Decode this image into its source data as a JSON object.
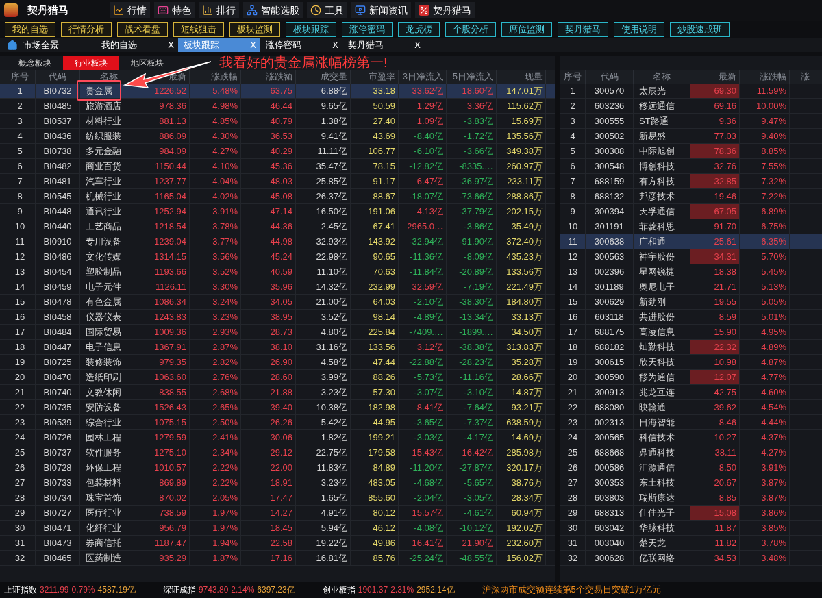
{
  "app": {
    "title": "契丹猎马"
  },
  "menu": [
    {
      "label": "行情"
    },
    {
      "label": "特色"
    },
    {
      "label": "排行"
    },
    {
      "label": "智能选股"
    },
    {
      "label": "工具"
    },
    {
      "label": "新闻资讯"
    },
    {
      "label": "契丹猎马"
    }
  ],
  "quick_buttons": [
    {
      "label": "我的自选",
      "kind": "gold"
    },
    {
      "label": "行情分析",
      "kind": "gold"
    },
    {
      "label": "战术看盘",
      "kind": "gold"
    },
    {
      "label": "短线狙击",
      "kind": "gold"
    },
    {
      "label": "板块监测",
      "kind": "gold"
    },
    {
      "label": "板块跟踪",
      "kind": "cyan"
    },
    {
      "label": "涨停密码",
      "kind": "cyan"
    },
    {
      "label": "龙虎榜",
      "kind": "cyan"
    },
    {
      "label": "个股分析",
      "kind": "cyan"
    },
    {
      "label": "席位监测",
      "kind": "cyan"
    },
    {
      "label": "契丹猎马",
      "kind": "cyan"
    },
    {
      "label": "使用说明",
      "kind": "cyan"
    },
    {
      "label": "炒股速成班",
      "kind": "cyan"
    }
  ],
  "home_tab": {
    "label": "市场全景"
  },
  "tabs": [
    {
      "label": "我的自选",
      "close": "X",
      "selected": false
    },
    {
      "label": "板块跟踪",
      "close": "X",
      "selected": true
    },
    {
      "label": "涨停密码",
      "close": "X",
      "selected": false
    },
    {
      "label": "契丹猎马",
      "close": "X",
      "selected": false
    }
  ],
  "sector_tabs": [
    {
      "label": "概念板块",
      "selected": false
    },
    {
      "label": "行业板块",
      "selected": true
    },
    {
      "label": "地区板块",
      "selected": false
    }
  ],
  "annotation": {
    "text": "我看好的贵金属涨幅榜第一!"
  },
  "sector_table": {
    "columns": [
      "序号",
      "代码",
      "名称",
      "最新",
      "涨跌幅",
      "涨跌额",
      "成交量",
      "市盈率",
      "3日净流入",
      "5日净流入",
      "现量"
    ],
    "rows": [
      {
        "selected": true,
        "inflow": [
          true,
          true
        ],
        "cells": [
          "1",
          "BI0732",
          "贵金属",
          "1226.52",
          "5.48%",
          "63.75",
          "6.88亿",
          "33.18",
          "33.62亿",
          "18.60亿",
          "147.01万"
        ]
      },
      {
        "selected": false,
        "inflow": [
          true,
          true
        ],
        "cells": [
          "2",
          "BI0485",
          "旅游酒店",
          "978.36",
          "4.98%",
          "46.44",
          "9.65亿",
          "50.59",
          "1.29亿",
          "3.36亿",
          "115.62万"
        ]
      },
      {
        "selected": false,
        "inflow": [
          true,
          false
        ],
        "cells": [
          "3",
          "BI0537",
          "材料行业",
          "881.13",
          "4.85%",
          "40.79",
          "1.38亿",
          "27.40",
          "1.09亿",
          "-3.83亿",
          "15.69万"
        ]
      },
      {
        "selected": false,
        "inflow": [
          false,
          false
        ],
        "cells": [
          "4",
          "BI0436",
          "纺织服装",
          "886.09",
          "4.30%",
          "36.53",
          "9.41亿",
          "43.69",
          "-8.40亿",
          "-1.72亿",
          "135.56万"
        ]
      },
      {
        "selected": false,
        "inflow": [
          false,
          false
        ],
        "cells": [
          "5",
          "BI0738",
          "多元金融",
          "984.09",
          "4.27%",
          "40.29",
          "11.11亿",
          "106.77",
          "-6.10亿",
          "-3.66亿",
          "349.38万"
        ]
      },
      {
        "selected": false,
        "inflow": [
          false,
          false
        ],
        "cells": [
          "6",
          "BI0482",
          "商业百货",
          "1150.44",
          "4.10%",
          "45.36",
          "35.47亿",
          "78.15",
          "-12.82亿",
          "-8335.…",
          "260.97万"
        ]
      },
      {
        "selected": false,
        "inflow": [
          true,
          false
        ],
        "cells": [
          "7",
          "BI0481",
          "汽车行业",
          "1237.77",
          "4.04%",
          "48.03",
          "25.85亿",
          "91.17",
          "6.47亿",
          "-36.97亿",
          "233.11万"
        ]
      },
      {
        "selected": false,
        "inflow": [
          false,
          false
        ],
        "cells": [
          "8",
          "BI0545",
          "机械行业",
          "1165.04",
          "4.02%",
          "45.08",
          "26.37亿",
          "88.67",
          "-18.07亿",
          "-73.66亿",
          "288.86万"
        ]
      },
      {
        "selected": false,
        "inflow": [
          true,
          false
        ],
        "cells": [
          "9",
          "BI0448",
          "通讯行业",
          "1252.94",
          "3.91%",
          "47.14",
          "16.50亿",
          "191.06",
          "4.13亿",
          "-37.79亿",
          "202.15万"
        ]
      },
      {
        "selected": false,
        "inflow": [
          true,
          false
        ],
        "cells": [
          "10",
          "BI0440",
          "工艺商品",
          "1218.54",
          "3.78%",
          "44.36",
          "2.45亿",
          "67.41",
          "2965.0…",
          "-3.86亿",
          "35.49万"
        ]
      },
      {
        "selected": false,
        "inflow": [
          false,
          false
        ],
        "cells": [
          "11",
          "BI0910",
          "专用设备",
          "1239.04",
          "3.77%",
          "44.98",
          "32.93亿",
          "143.92",
          "-32.94亿",
          "-91.90亿",
          "372.40万"
        ]
      },
      {
        "selected": false,
        "inflow": [
          false,
          false
        ],
        "cells": [
          "12",
          "BI0486",
          "文化传媒",
          "1314.15",
          "3.56%",
          "45.24",
          "22.98亿",
          "90.65",
          "-11.36亿",
          "-8.09亿",
          "435.23万"
        ]
      },
      {
        "selected": false,
        "inflow": [
          false,
          false
        ],
        "cells": [
          "13",
          "BI0454",
          "塑胶制品",
          "1193.66",
          "3.52%",
          "40.59",
          "11.10亿",
          "70.63",
          "-11.84亿",
          "-20.89亿",
          "133.56万"
        ]
      },
      {
        "selected": false,
        "inflow": [
          true,
          false
        ],
        "cells": [
          "14",
          "BI0459",
          "电子元件",
          "1126.11",
          "3.30%",
          "35.96",
          "14.32亿",
          "232.99",
          "32.59亿",
          "-7.19亿",
          "221.49万"
        ]
      },
      {
        "selected": false,
        "inflow": [
          false,
          false
        ],
        "cells": [
          "15",
          "BI0478",
          "有色金属",
          "1086.34",
          "3.24%",
          "34.05",
          "21.00亿",
          "64.03",
          "-2.10亿",
          "-38.30亿",
          "184.80万"
        ]
      },
      {
        "selected": false,
        "inflow": [
          false,
          false
        ],
        "cells": [
          "16",
          "BI0458",
          "仪器仪表",
          "1243.83",
          "3.23%",
          "38.95",
          "3.52亿",
          "98.14",
          "-4.89亿",
          "-13.34亿",
          "33.13万"
        ]
      },
      {
        "selected": false,
        "inflow": [
          false,
          false
        ],
        "cells": [
          "17",
          "BI0484",
          "国际贸易",
          "1009.36",
          "2.93%",
          "28.73",
          "4.80亿",
          "225.84",
          "-7409.…",
          "-1899.…",
          "34.50万"
        ]
      },
      {
        "selected": false,
        "inflow": [
          true,
          false
        ],
        "cells": [
          "18",
          "BI0447",
          "电子信息",
          "1367.91",
          "2.87%",
          "38.10",
          "31.16亿",
          "133.56",
          "3.12亿",
          "-38.38亿",
          "313.83万"
        ]
      },
      {
        "selected": false,
        "inflow": [
          false,
          false
        ],
        "cells": [
          "19",
          "BI0725",
          "装修装饰",
          "979.35",
          "2.82%",
          "26.90",
          "4.58亿",
          "47.44",
          "-22.88亿",
          "-28.23亿",
          "35.28万"
        ]
      },
      {
        "selected": false,
        "inflow": [
          false,
          false
        ],
        "cells": [
          "20",
          "BI0470",
          "造纸印刷",
          "1063.60",
          "2.76%",
          "28.60",
          "3.99亿",
          "88.26",
          "-5.73亿",
          "-11.16亿",
          "28.66万"
        ]
      },
      {
        "selected": false,
        "inflow": [
          false,
          false
        ],
        "cells": [
          "21",
          "BI0740",
          "文教休闲",
          "838.55",
          "2.68%",
          "21.88",
          "3.23亿",
          "57.30",
          "-3.07亿",
          "-3.10亿",
          "14.87万"
        ]
      },
      {
        "selected": false,
        "inflow": [
          true,
          false
        ],
        "cells": [
          "22",
          "BI0735",
          "安防设备",
          "1526.43",
          "2.65%",
          "39.40",
          "10.38亿",
          "182.98",
          "8.41亿",
          "-7.64亿",
          "93.21万"
        ]
      },
      {
        "selected": false,
        "inflow": [
          false,
          false
        ],
        "cells": [
          "23",
          "BI0539",
          "综合行业",
          "1075.15",
          "2.50%",
          "26.26",
          "5.42亿",
          "44.95",
          "-3.65亿",
          "-7.37亿",
          "638.59万"
        ]
      },
      {
        "selected": false,
        "inflow": [
          false,
          false
        ],
        "cells": [
          "24",
          "BI0726",
          "园林工程",
          "1279.59",
          "2.41%",
          "30.06",
          "1.82亿",
          "199.21",
          "-3.03亿",
          "-4.17亿",
          "14.69万"
        ]
      },
      {
        "selected": false,
        "inflow": [
          true,
          true
        ],
        "cells": [
          "25",
          "BI0737",
          "软件服务",
          "1275.10",
          "2.34%",
          "29.12",
          "22.75亿",
          "179.58",
          "15.43亿",
          "16.42亿",
          "285.98万"
        ]
      },
      {
        "selected": false,
        "inflow": [
          false,
          false
        ],
        "cells": [
          "26",
          "BI0728",
          "环保工程",
          "1010.57",
          "2.22%",
          "22.00",
          "11.83亿",
          "84.89",
          "-11.20亿",
          "-27.87亿",
          "320.17万"
        ]
      },
      {
        "selected": false,
        "inflow": [
          false,
          false
        ],
        "cells": [
          "27",
          "BI0733",
          "包装材料",
          "869.89",
          "2.22%",
          "18.91",
          "3.23亿",
          "483.05",
          "-4.68亿",
          "-5.65亿",
          "38.76万"
        ]
      },
      {
        "selected": false,
        "inflow": [
          false,
          false
        ],
        "cells": [
          "28",
          "BI0734",
          "珠宝首饰",
          "870.02",
          "2.05%",
          "17.47",
          "1.65亿",
          "855.60",
          "-2.04亿",
          "-3.05亿",
          "28.34万"
        ]
      },
      {
        "selected": false,
        "inflow": [
          true,
          false
        ],
        "cells": [
          "29",
          "BI0727",
          "医疗行业",
          "738.59",
          "1.97%",
          "14.27",
          "4.91亿",
          "80.12",
          "15.57亿",
          "-4.61亿",
          "60.94万"
        ]
      },
      {
        "selected": false,
        "inflow": [
          false,
          false
        ],
        "cells": [
          "30",
          "BI0471",
          "化纤行业",
          "956.79",
          "1.97%",
          "18.45",
          "5.94亿",
          "46.12",
          "-4.08亿",
          "-10.12亿",
          "192.02万"
        ]
      },
      {
        "selected": false,
        "inflow": [
          true,
          true
        ],
        "cells": [
          "31",
          "BI0473",
          "券商信托",
          "1187.47",
          "1.94%",
          "22.58",
          "19.22亿",
          "49.86",
          "16.41亿",
          "21.90亿",
          "232.60万"
        ]
      },
      {
        "selected": false,
        "inflow": [
          false,
          false
        ],
        "cells": [
          "32",
          "BI0465",
          "医药制造",
          "935.29",
          "1.87%",
          "17.16",
          "16.81亿",
          "85.76",
          "-25.24亿",
          "-48.55亿",
          "156.02万"
        ]
      }
    ]
  },
  "stock_table": {
    "columns": [
      "序号",
      "代码",
      "名称",
      "最新",
      "涨跌幅",
      "涨"
    ],
    "rows": [
      {
        "selected": false,
        "highlighted": true,
        "cells": [
          "1",
          "300570",
          "太辰光",
          "69.30",
          "11.59%"
        ]
      },
      {
        "selected": false,
        "highlighted": false,
        "cells": [
          "2",
          "603236",
          "移远通信",
          "69.16",
          "10.00%"
        ]
      },
      {
        "selected": false,
        "highlighted": false,
        "cells": [
          "3",
          "300555",
          "ST路通",
          "9.36",
          "9.47%"
        ]
      },
      {
        "selected": false,
        "highlighted": false,
        "cells": [
          "4",
          "300502",
          "新易盛",
          "77.03",
          "9.40%"
        ]
      },
      {
        "selected": false,
        "highlighted": true,
        "cells": [
          "5",
          "300308",
          "中际旭创",
          "78.36",
          "8.85%"
        ]
      },
      {
        "selected": false,
        "highlighted": false,
        "cells": [
          "6",
          "300548",
          "博创科技",
          "32.76",
          "7.55%"
        ]
      },
      {
        "selected": false,
        "highlighted": true,
        "cells": [
          "7",
          "688159",
          "有方科技",
          "32.85",
          "7.32%"
        ]
      },
      {
        "selected": false,
        "highlighted": false,
        "cells": [
          "8",
          "688132",
          "邦彦技术",
          "19.46",
          "7.22%"
        ]
      },
      {
        "selected": false,
        "highlighted": true,
        "cells": [
          "9",
          "300394",
          "天孚通信",
          "67.05",
          "6.89%"
        ]
      },
      {
        "selected": false,
        "highlighted": false,
        "cells": [
          "10",
          "301191",
          "菲菱科思",
          "91.70",
          "6.75%"
        ]
      },
      {
        "selected": true,
        "highlighted": false,
        "cells": [
          "11",
          "300638",
          "广和通",
          "25.61",
          "6.35%"
        ]
      },
      {
        "selected": false,
        "highlighted": true,
        "cells": [
          "12",
          "300563",
          "神宇股份",
          "34.31",
          "5.70%"
        ]
      },
      {
        "selected": false,
        "highlighted": false,
        "cells": [
          "13",
          "002396",
          "星网锐捷",
          "18.38",
          "5.45%"
        ]
      },
      {
        "selected": false,
        "highlighted": false,
        "cells": [
          "14",
          "301189",
          "奥尼电子",
          "21.71",
          "5.13%"
        ]
      },
      {
        "selected": false,
        "highlighted": false,
        "cells": [
          "15",
          "300629",
          "新劲刚",
          "19.55",
          "5.05%"
        ]
      },
      {
        "selected": false,
        "highlighted": false,
        "cells": [
          "16",
          "603118",
          "共进股份",
          "8.59",
          "5.01%"
        ]
      },
      {
        "selected": false,
        "highlighted": false,
        "cells": [
          "17",
          "688175",
          "高凌信息",
          "15.90",
          "4.95%"
        ]
      },
      {
        "selected": false,
        "highlighted": true,
        "cells": [
          "18",
          "688182",
          "灿勤科技",
          "22.32",
          "4.89%"
        ]
      },
      {
        "selected": false,
        "highlighted": false,
        "cells": [
          "19",
          "300615",
          "欣天科技",
          "10.98",
          "4.87%"
        ]
      },
      {
        "selected": false,
        "highlighted": true,
        "cells": [
          "20",
          "300590",
          "移为通信",
          "12.07",
          "4.77%"
        ]
      },
      {
        "selected": false,
        "highlighted": false,
        "cells": [
          "21",
          "300913",
          "兆龙互连",
          "42.75",
          "4.60%"
        ]
      },
      {
        "selected": false,
        "highlighted": false,
        "cells": [
          "22",
          "688080",
          "映翰通",
          "39.62",
          "4.54%"
        ]
      },
      {
        "selected": false,
        "highlighted": false,
        "cells": [
          "23",
          "002313",
          "日海智能",
          "8.46",
          "4.44%"
        ]
      },
      {
        "selected": false,
        "highlighted": false,
        "cells": [
          "24",
          "300565",
          "科信技术",
          "10.27",
          "4.37%"
        ]
      },
      {
        "selected": false,
        "highlighted": false,
        "cells": [
          "25",
          "688668",
          "鼎通科技",
          "38.11",
          "4.27%"
        ]
      },
      {
        "selected": false,
        "highlighted": false,
        "cells": [
          "26",
          "000586",
          "汇源通信",
          "8.50",
          "3.91%"
        ]
      },
      {
        "selected": false,
        "highlighted": false,
        "cells": [
          "27",
          "300353",
          "东土科技",
          "20.67",
          "3.87%"
        ]
      },
      {
        "selected": false,
        "highlighted": false,
        "cells": [
          "28",
          "603803",
          "瑞斯康达",
          "8.85",
          "3.87%"
        ]
      },
      {
        "selected": false,
        "highlighted": true,
        "cells": [
          "29",
          "688313",
          "仕佳光子",
          "15.08",
          "3.86%"
        ]
      },
      {
        "selected": false,
        "highlighted": false,
        "cells": [
          "30",
          "603042",
          "华脉科技",
          "11.87",
          "3.85%"
        ]
      },
      {
        "selected": false,
        "highlighted": false,
        "cells": [
          "31",
          "003040",
          "楚天龙",
          "11.82",
          "3.78%"
        ]
      },
      {
        "selected": false,
        "highlighted": false,
        "cells": [
          "32",
          "300628",
          "亿联网络",
          "34.53",
          "3.48%"
        ]
      }
    ]
  },
  "status_bar": {
    "indices": [
      {
        "name": "上证指数",
        "price": "3211.99",
        "change": "0.79%",
        "amount": "4587.19亿"
      },
      {
        "name": "深证成指",
        "price": "9743.80",
        "change": "2.14%",
        "amount": "6397.23亿"
      },
      {
        "name": "创业板指",
        "price": "1901.37",
        "change": "2.31%",
        "amount": "2952.14亿"
      }
    ],
    "news": "沪深两市成交额连续第5个交易日突破1万亿元"
  }
}
